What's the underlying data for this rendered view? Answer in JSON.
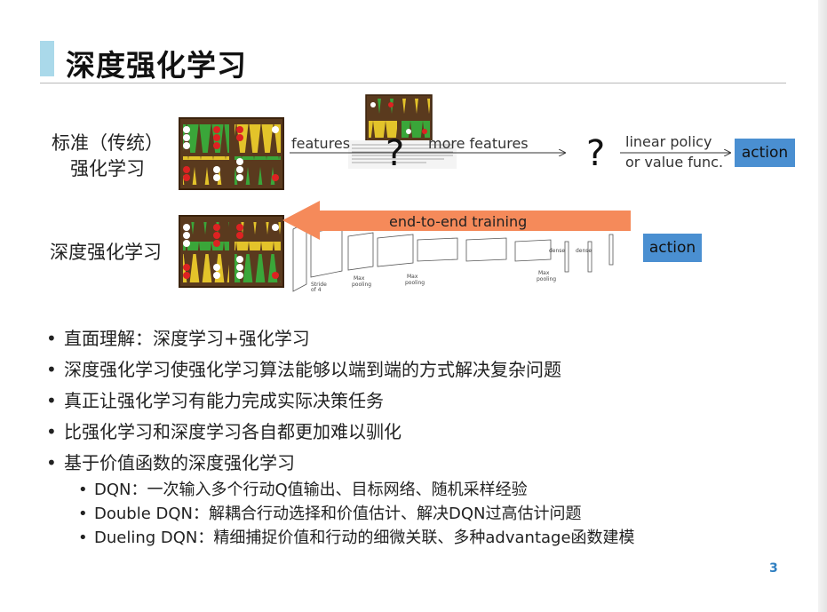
{
  "slide": {
    "title": "深度强化学习",
    "page_number": "3"
  },
  "diagram": {
    "row1": {
      "label_line1": "标准（传统）",
      "label_line2": "强化学习",
      "features": "features",
      "more_features": "more features",
      "question_mark": "?",
      "policy_line1": "linear policy",
      "policy_line2": "or value func.",
      "action": "action"
    },
    "row2": {
      "label": "深度强化学习",
      "end_to_end": "end-to-end training",
      "action": "action"
    },
    "colors": {
      "action_box": "#4a8fd1",
      "arrow": "#f58a5a",
      "accent": "#aad9ea"
    }
  },
  "bullets": [
    {
      "text": "直面理解：深度学习+强化学习"
    },
    {
      "text": "深度强化学习使强化学习算法能够以端到端的方式解决复杂问题"
    },
    {
      "text": "真正让强化学习有能力完成实际决策任务"
    },
    {
      "text": "比强化学习和深度学习各自都更加难以驯化"
    },
    {
      "text": "基于价值函数的深度强化学习"
    }
  ],
  "sub_bullets": [
    {
      "text": "DQN：一次输入多个行动Q值输出、目标网络、随机采样经验"
    },
    {
      "text": "Double DQN：解耦合行动选择和价值估计、解决DQN过高估计问题"
    },
    {
      "text": "Dueling DQN：精细捕捉价值和行动的细微关联、多种advantage函数建模"
    }
  ]
}
